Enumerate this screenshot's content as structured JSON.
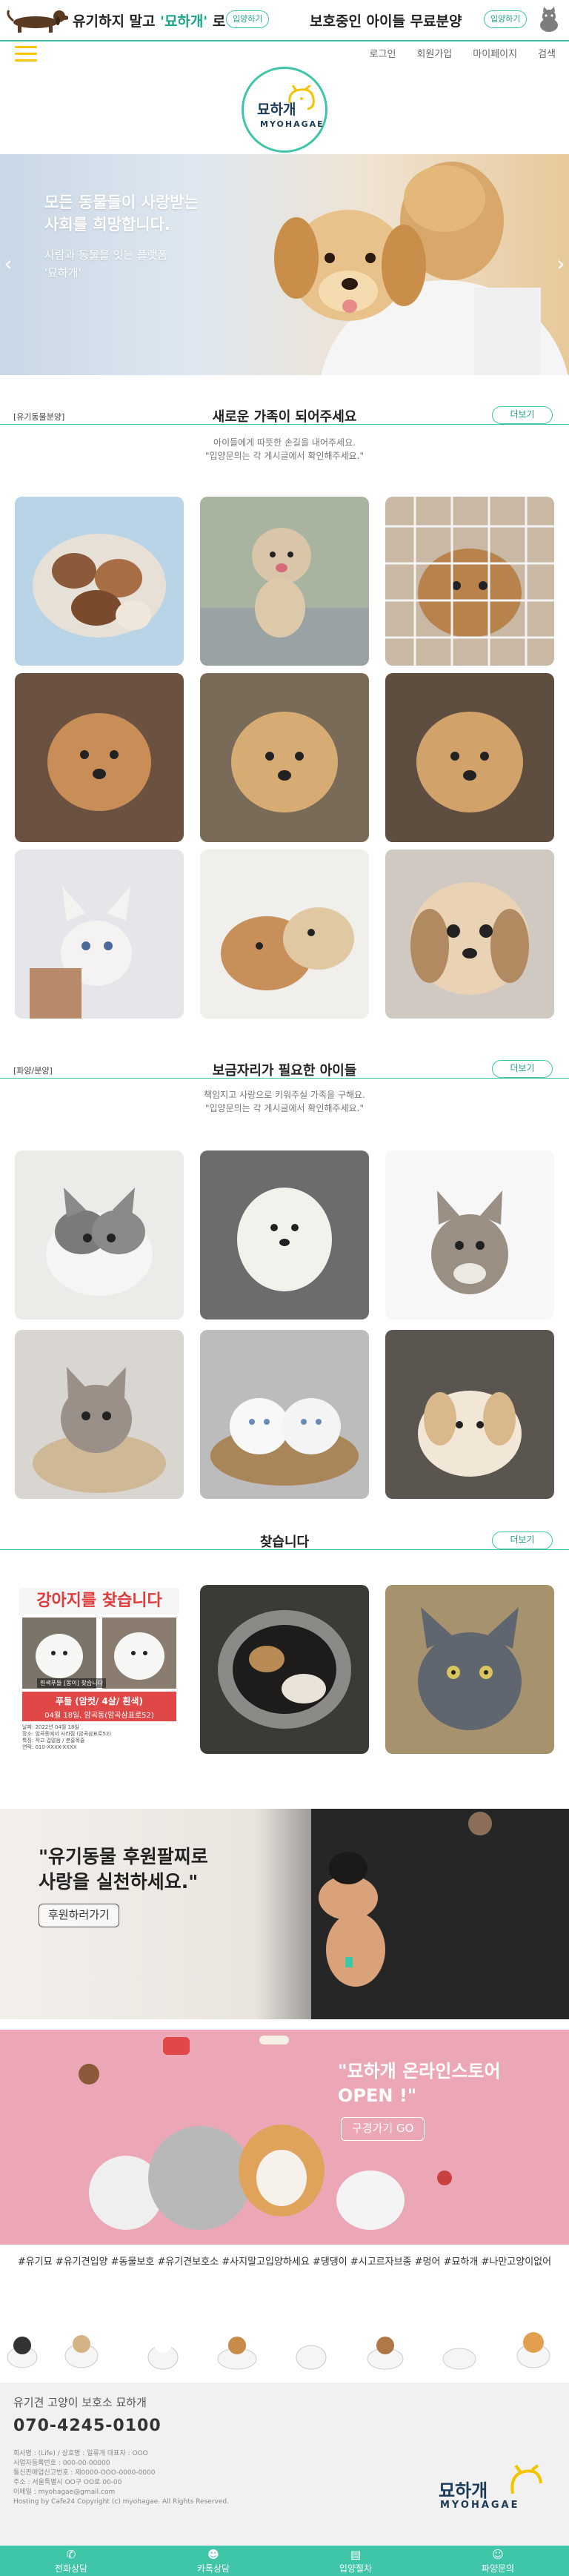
{
  "top_banner": {
    "left_text_pre": "유기하지 말고 ",
    "left_text_brand": "'묘하개'",
    "left_text_post": " 로",
    "left_button": "입양하기",
    "right_text": "보호중인 아이들 무료분양",
    "right_button": "입양하기"
  },
  "header": {
    "links": [
      "로그인",
      "회원가입",
      "마이페이지",
      "검색"
    ],
    "logo_kr": "묘하개",
    "logo_en": "MYOHAGAE"
  },
  "hero": {
    "title_line1": "모든 동물들이 사랑받는",
    "title_line2": "사회를 희망합니다.",
    "sub_line1": "사람과 동물을 잇는 플랫폼",
    "sub_line2": "'묘하개'"
  },
  "sections": {
    "adopt": {
      "tag": "[유기동물분양]",
      "title": "새로운 가족이 되어주세요",
      "desc1": "아이들에게 따뜻한 손길을 내어주세요.",
      "desc2": "\"입양문의는 각 게시글에서 확인해주세요.\"",
      "more": "더보기"
    },
    "foster": {
      "tag": "[파양/분양]",
      "title": "보금자리가 필요한 아이들",
      "desc1": "책임지고 사랑으로 키워주실 가족을 구해요.",
      "desc2": "\"입양문의는 각 게시글에서 확인해주세요.\"",
      "more": "더보기"
    },
    "missing": {
      "title": "찾습니다",
      "more": "더보기",
      "poster_title": "강아지를 찾습니다",
      "poster_caption": "흰색푸들 [몽이] 찾습니다",
      "poster_name": "푸들 (암컷/ 4살/ 흰색)",
      "poster_date": "04월 18일, 암곡동(암곡삼표로52)",
      "poster_lines": [
        "날짜: 2022년 04월 18일",
        "장소: 암곡동에서 사라짐 (암곡삼표로52)",
        "특징: 작고 겁많음 / 분홍목줄",
        "연락: 010-XXXX-XXXX"
      ]
    }
  },
  "banners": {
    "sponsor_line1": "\"유기동물 후원팔찌로",
    "sponsor_line2": "사랑을 실천하세요.\"",
    "sponsor_button": "후원하러가기",
    "store_line1": "\"묘하개 온라인스토어",
    "store_line2": "OPEN !\"",
    "store_button": "구경가기 GO"
  },
  "hashtags": "#유기묘 #유기견입양 #동물보호 #유기견보호소 #사지말고입양하세요 #댕댕이 #시고르자브종 #멍어 #묘하개 #나만고양이없어",
  "footer": {
    "name": "유기견 고양이 보호소 묘하개",
    "phone": "070-4245-0100",
    "info_lines": [
      "회사명 : (Life) / 상호명 : 일류개 대표자 : OOO",
      "사업자등록번호 : 000-00-00000",
      "통신판매업신고번호 : 제0000-OOO-0000-0000",
      "주소 : 서울특별시 OO구 OO로 00-00",
      "이메일 : myohagae@gmail.com",
      "Hosting by Cafe24 Copyright (c) myohagae. All Rights Reserved."
    ],
    "logo_kr": "묘하개",
    "logo_en": "MYOHAGAE"
  },
  "bottom_bar": [
    "전화상담",
    "카톡상담",
    "입양절차",
    "파양문의"
  ],
  "colors": {
    "accent": "#3fc6a8",
    "accent_dark": "#1ca489",
    "menu": "#f2c500",
    "brand_navy": "#1b3a57"
  },
  "icons": {
    "menu": "hamburger-icon",
    "phone": "phone-icon",
    "chat": "chat-icon",
    "process": "clipboard-icon",
    "inquiry": "cat-icon"
  }
}
